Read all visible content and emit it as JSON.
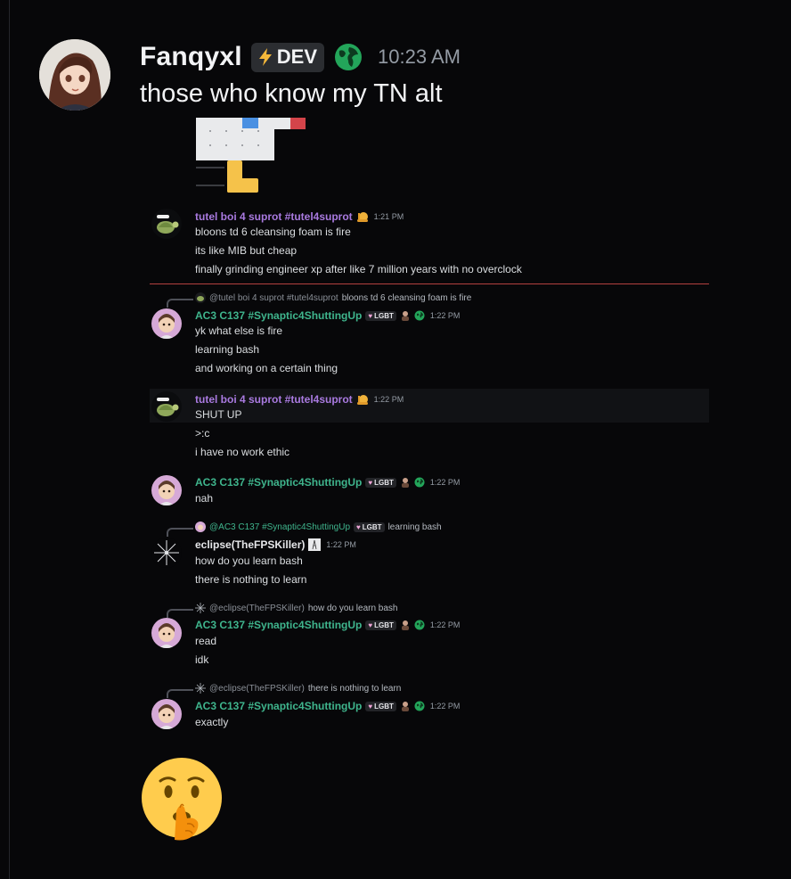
{
  "main_message": {
    "username": "Fanqyxl",
    "badge": "DEV",
    "timestamp": "10:23 AM",
    "text": "those who know my TN alt"
  },
  "embedded_messages": [
    {
      "author": "tutel boi 4 suprot #tutel4suprot",
      "time": "1:21 PM",
      "lines": [
        "bloons td 6 cleansing foam is fire",
        "its like MIB but cheap",
        "finally grinding engineer xp after like 7 million years with no overclock"
      ]
    },
    {
      "reply_to": "@tutel boi 4 suprot #tutel4suprot",
      "reply_text": "bloons td 6 cleansing foam is fire",
      "author": "AC3 C137 #Synaptic4ShuttingUp",
      "tag": "LGBT",
      "time": "1:22 PM",
      "lines": [
        "yk what else is fire",
        "learning bash",
        "and working on a certain thing"
      ]
    },
    {
      "author": "tutel boi 4 suprot #tutel4suprot",
      "time": "1:22 PM",
      "lines": [
        "SHUT UP",
        ">:c",
        "i have no work ethic"
      ]
    },
    {
      "author": "AC3 C137 #Synaptic4ShuttingUp",
      "tag": "LGBT",
      "time": "1:22 PM",
      "lines": [
        "nah"
      ]
    },
    {
      "reply_to": "@AC3 C137 #Synaptic4ShuttingUp",
      "reply_tag": "LGBT",
      "reply_text": "learning bash",
      "author": "eclipse(TheFPSKiller)",
      "time": "1:22 PM",
      "lines": [
        "how do you learn bash",
        "there is nothing to learn"
      ]
    },
    {
      "reply_to": "@eclipse(TheFPSKiller)",
      "reply_text": "how do you learn bash",
      "author": "AC3 C137 #Synaptic4ShuttingUp",
      "tag": "LGBT",
      "time": "1:22 PM",
      "lines": [
        "read",
        "idk"
      ]
    },
    {
      "reply_to": "@eclipse(TheFPSKiller)",
      "reply_text": "there is nothing to learn",
      "author": "AC3 C137 #Synaptic4ShuttingUp",
      "tag": "LGBT",
      "time": "1:22 PM",
      "lines": [
        "exactly"
      ]
    }
  ],
  "colors": {
    "background": "#070709",
    "tutel_name": "#a97ae0",
    "ac3_name": "#3fb58d",
    "divider": "#b3413f"
  },
  "icons": [
    "lightning-icon",
    "globe-icon",
    "shushing-face-emoji",
    "turtle-avatar",
    "snail-icon",
    "crosshair-avatar"
  ]
}
